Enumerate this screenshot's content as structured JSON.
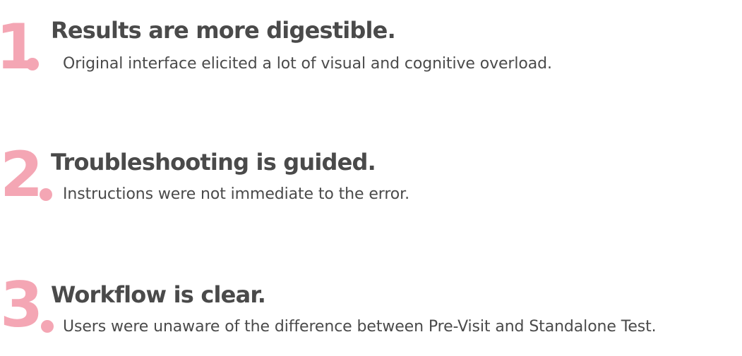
{
  "accent_color": "#f4a6b4",
  "text_color": "#4a4a4a",
  "items": [
    {
      "number": "1",
      "heading": "Results are more digestible.",
      "description": "Original interface elicited a lot of visual and cognitive overload."
    },
    {
      "number": "2",
      "heading": "Troubleshooting is guided.",
      "description": "Instructions were not immediate to the error."
    },
    {
      "number": "3",
      "heading": "Workflow is clear.",
      "description": "Users were unaware of the difference between Pre-Visit and Standalone Test."
    }
  ]
}
